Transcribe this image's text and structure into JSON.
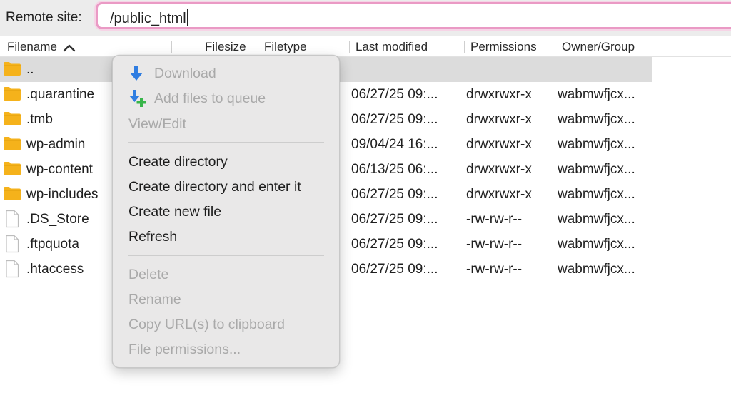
{
  "sitebar": {
    "label": "Remote site:",
    "path": "/public_html"
  },
  "columns": {
    "filename": "Filename",
    "filesize": "Filesize",
    "filetype": "Filetype",
    "last_modified": "Last modified",
    "permissions": "Permissions",
    "owner_group": "Owner/Group"
  },
  "files": [
    {
      "name": "..",
      "icon": "folder-icon",
      "modified": "",
      "permissions": "",
      "owner": ""
    },
    {
      "name": ".quarantine",
      "icon": "folder-icon",
      "modified": "06/27/25 09:...",
      "permissions": "drwxrwxr-x",
      "owner": "wabmwfjcx..."
    },
    {
      "name": ".tmb",
      "icon": "folder-icon",
      "modified": "06/27/25 09:...",
      "permissions": "drwxrwxr-x",
      "owner": "wabmwfjcx..."
    },
    {
      "name": "wp-admin",
      "icon": "folder-icon",
      "modified": "09/04/24 16:...",
      "permissions": "drwxrwxr-x",
      "owner": "wabmwfjcx..."
    },
    {
      "name": "wp-content",
      "icon": "folder-icon",
      "modified": "06/13/25 06:...",
      "permissions": "drwxrwxr-x",
      "owner": "wabmwfjcx..."
    },
    {
      "name": "wp-includes",
      "icon": "folder-icon",
      "modified": "06/27/25 09:...",
      "permissions": "drwxrwxr-x",
      "owner": "wabmwfjcx..."
    },
    {
      "name": ".DS_Store",
      "icon": "file-icon",
      "modified": "06/27/25 09:...",
      "permissions": "-rw-rw-r--",
      "owner": "wabmwfjcx..."
    },
    {
      "name": ".ftpquota",
      "icon": "file-icon",
      "modified": "06/27/25 09:...",
      "permissions": "-rw-rw-r--",
      "owner": "wabmwfjcx..."
    },
    {
      "name": ".htaccess",
      "icon": "file-icon",
      "modified": "06/27/25 09:...",
      "permissions": "-rw-rw-r--",
      "owner": "wabmwfjcx..."
    }
  ],
  "context_menu": {
    "download": "Download",
    "add_to_queue": "Add files to queue",
    "view_edit": "View/Edit",
    "create_directory": "Create directory",
    "create_directory_enter": "Create directory and enter it",
    "create_new_file": "Create new file",
    "refresh": "Refresh",
    "delete": "Delete",
    "rename": "Rename",
    "copy_url": "Copy URL(s) to clipboard",
    "file_permissions": "File permissions..."
  },
  "colors": {
    "folder": "#f5b21b",
    "focus_ring": "#ea9ac5",
    "selected_row": "#dcdcdc",
    "download_arrow": "#2f7de1",
    "add_plus": "#38b54a",
    "disabled_text": "#a9a9a9"
  }
}
